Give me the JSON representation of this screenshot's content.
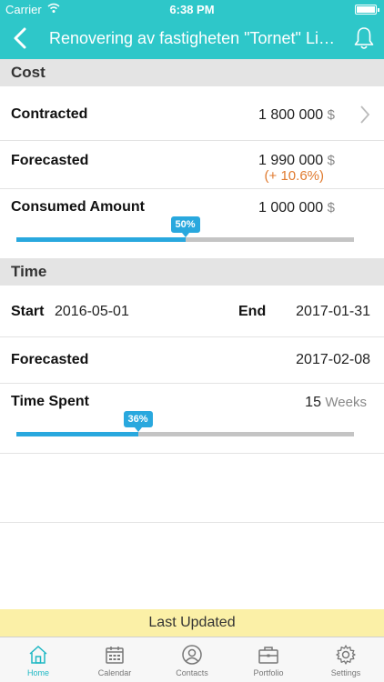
{
  "status_bar": {
    "carrier": "Carrier",
    "time": "6:38 PM"
  },
  "nav": {
    "title": "Renovering av fastigheten \"Tornet\" Limhamn"
  },
  "cost": {
    "header": "Cost",
    "contracted": {
      "label": "Contracted",
      "value": "1 800 000",
      "unit": "$"
    },
    "forecasted": {
      "label": "Forecasted",
      "value": "1 990 000",
      "unit": "$",
      "delta": "(+ 10.6%)"
    },
    "consumed": {
      "label": "Consumed Amount",
      "value": "1 000 000",
      "unit": "$",
      "progress_label": "50%",
      "progress_fraction": 0.5
    }
  },
  "time": {
    "header": "Time",
    "start_label": "Start",
    "start_value": "2016-05-01",
    "end_label": "End",
    "end_value": "2017-01-31",
    "forecasted": {
      "label": "Forecasted",
      "value": "2017-02-08"
    },
    "spent": {
      "label": "Time Spent",
      "value": "15",
      "unit": "Weeks",
      "progress_label": "36%",
      "progress_fraction": 0.36
    }
  },
  "footer": {
    "last_updated": "Last Updated"
  },
  "tabs": [
    {
      "label": "Home",
      "icon": "home-icon",
      "active": true
    },
    {
      "label": "Calendar",
      "icon": "calendar-icon"
    },
    {
      "label": "Contacts",
      "icon": "contacts-icon"
    },
    {
      "label": "Portfolio",
      "icon": "briefcase-icon"
    },
    {
      "label": "Settings",
      "icon": "gear-icon"
    }
  ],
  "colors": {
    "accent": "#2ec7c9",
    "progress": "#29a8de",
    "delta": "#e07a2e",
    "tab_active": "#1fb8c4",
    "banner": "#fbf0a7"
  }
}
